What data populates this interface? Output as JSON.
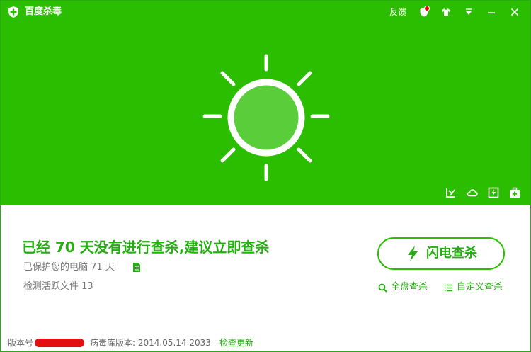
{
  "app": {
    "title": "百度杀毒"
  },
  "titlebar": {
    "feedback_label": "反馈"
  },
  "status": {
    "headline": "已经 70 天没有进行查杀,建议立即查杀",
    "protected_text": "已保护您的电脑 71 天",
    "active_files_text": "检测活跃文件 13"
  },
  "actions": {
    "flash_scan_label": "闪电查杀",
    "full_scan_label": "全盘查杀",
    "custom_scan_label": "自定义查杀"
  },
  "footer": {
    "version_label": "版本号",
    "virus_db_label": "病毒库版本: 2014.05.14 2033",
    "check_update_label": "检查更新"
  },
  "colors": {
    "brand_green": "#2bbe00",
    "text_green": "#24ae10",
    "sun_fill": "#5acd3a",
    "notification_dot": "#e40000"
  },
  "icons": [
    "shield-logo-icon",
    "shield-notify-icon",
    "skin-shirt-icon",
    "menu-dropdown-icon",
    "minimize-icon",
    "close-icon",
    "sun-status-icon",
    "speed-tool-icon",
    "cloud-icon",
    "flash-tool-icon",
    "medkit-icon",
    "document-icon",
    "lightning-icon",
    "search-icon",
    "list-icon"
  ]
}
